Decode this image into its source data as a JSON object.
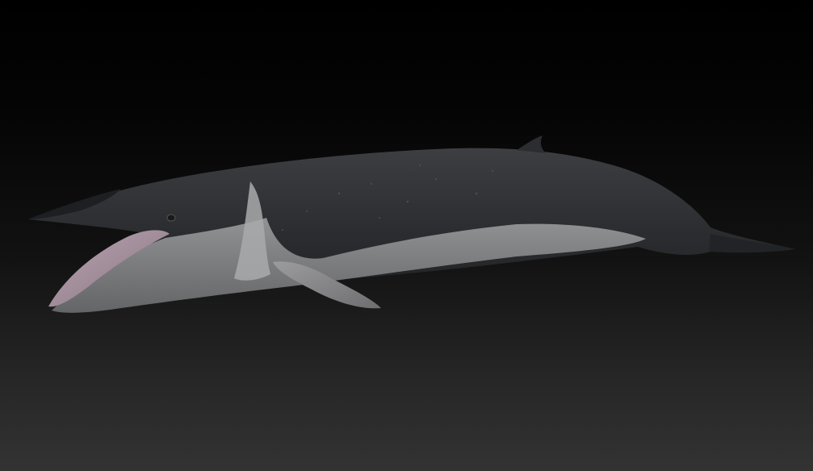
{
  "scene": {
    "subject": "whale-render",
    "colors": {
      "background_top": "#000000",
      "background_bottom": "#333333",
      "body_dark": "#2a2b2e",
      "body_light": "#8f9092",
      "mouth": "#a8909e"
    }
  }
}
